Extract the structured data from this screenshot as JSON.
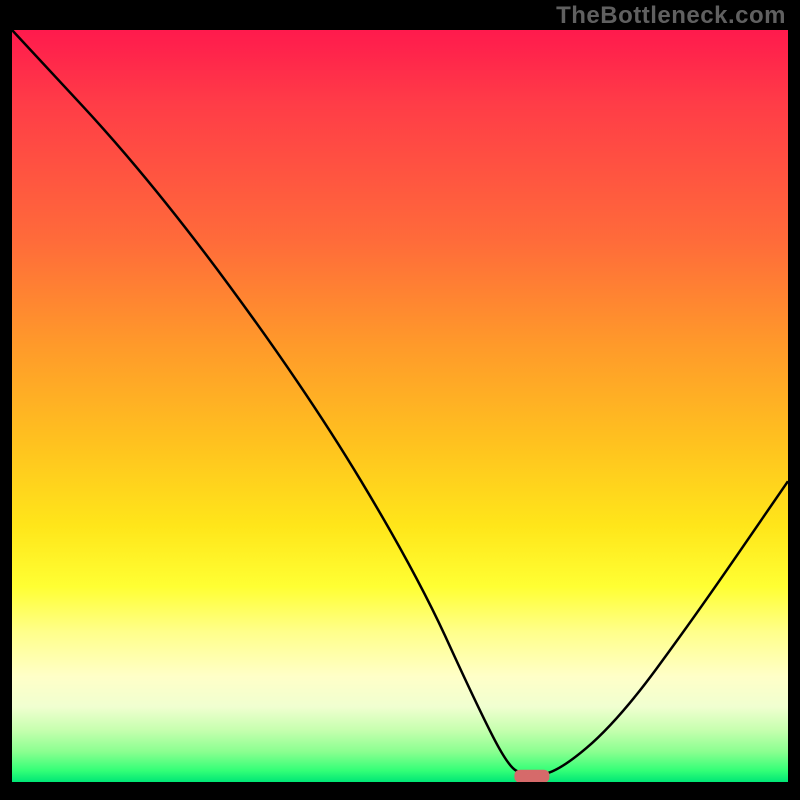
{
  "attribution": "TheBottleneck.com",
  "chart_data": {
    "type": "line",
    "title": "",
    "xlabel": "",
    "ylabel": "",
    "xlim": [
      0,
      100
    ],
    "ylim": [
      0,
      100
    ],
    "background_gradient": {
      "from": "#ff1a4d",
      "through": [
        "#ff9a2a",
        "#ffe61a",
        "#ffff8a",
        "#c8ffb0"
      ],
      "to": "#00e676",
      "meaning": "red=high bottleneck, green=optimal"
    },
    "series": [
      {
        "name": "bottleneck-curve",
        "x": [
          0,
          18,
          38,
          52,
          60,
          64,
          66,
          70,
          78,
          88,
          100
        ],
        "values": [
          100,
          80,
          52,
          28,
          10,
          2,
          1,
          1,
          8,
          22,
          40
        ]
      }
    ],
    "marker": {
      "x": 67,
      "y": 0.5,
      "color": "#d66a6a",
      "label": "optimal-point"
    }
  }
}
